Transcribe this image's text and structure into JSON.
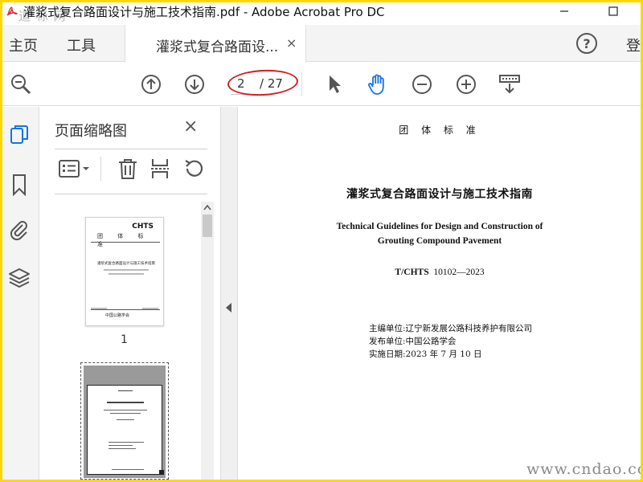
{
  "window": {
    "title": "灌浆式复合路面设计与施工技术指南.pdf - Adobe Acrobat Pro DC",
    "watermark_logo": "道 标 网"
  },
  "tabs": {
    "home": "主页",
    "tools": "工具",
    "document": "灌浆式复合路面设...",
    "close": "×",
    "help": "?",
    "signin": "登"
  },
  "toolbar": {
    "current_page": "2",
    "total_pages": "/ 27"
  },
  "thumbnail_panel": {
    "title": "页面缩略图",
    "close": "×",
    "thumb1": {
      "chts": "CHTS",
      "std": "团 体 标 准",
      "title": "灌浆式复合路面设计与施工技术指南",
      "publisher": "中国公路学会",
      "page_number": "1"
    }
  },
  "document": {
    "std_label": "团 体 标 准",
    "title_cn": "灌浆式复合路面设计与施工技术指南",
    "title_en_1": "Technical Guidelines for Design and Construction of",
    "title_en_2": "Grouting Compound Pavement",
    "code_prefix": "T/CHTS",
    "code_number": "10102—2023",
    "editor": "主编单位:辽宁新发展公路科技养护有限公司",
    "publisher": "发布单位:中国公路学会",
    "effective_date": "实施日期:2023 年 7 月 10 日"
  },
  "site_watermark": "www.cndao.com",
  "colors": {
    "frame": "#ffd800",
    "annotation": "#d42020",
    "hand_tool": "#1473e6",
    "pdf_red": "#d32f2f"
  }
}
